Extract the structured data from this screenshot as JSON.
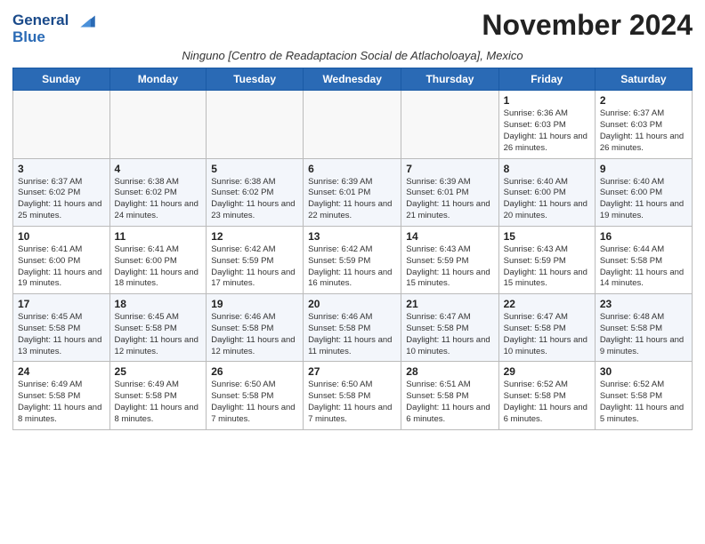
{
  "header": {
    "logo_line1": "General",
    "logo_line2": "Blue",
    "month_title": "November 2024",
    "subtitle": "Ninguno [Centro de Readaptacion Social de Atlacholoaya], Mexico"
  },
  "days_of_week": [
    "Sunday",
    "Monday",
    "Tuesday",
    "Wednesday",
    "Thursday",
    "Friday",
    "Saturday"
  ],
  "weeks": [
    [
      {
        "day": "",
        "info": ""
      },
      {
        "day": "",
        "info": ""
      },
      {
        "day": "",
        "info": ""
      },
      {
        "day": "",
        "info": ""
      },
      {
        "day": "",
        "info": ""
      },
      {
        "day": "1",
        "info": "Sunrise: 6:36 AM\nSunset: 6:03 PM\nDaylight: 11 hours and 26 minutes."
      },
      {
        "day": "2",
        "info": "Sunrise: 6:37 AM\nSunset: 6:03 PM\nDaylight: 11 hours and 26 minutes."
      }
    ],
    [
      {
        "day": "3",
        "info": "Sunrise: 6:37 AM\nSunset: 6:02 PM\nDaylight: 11 hours and 25 minutes."
      },
      {
        "day": "4",
        "info": "Sunrise: 6:38 AM\nSunset: 6:02 PM\nDaylight: 11 hours and 24 minutes."
      },
      {
        "day": "5",
        "info": "Sunrise: 6:38 AM\nSunset: 6:02 PM\nDaylight: 11 hours and 23 minutes."
      },
      {
        "day": "6",
        "info": "Sunrise: 6:39 AM\nSunset: 6:01 PM\nDaylight: 11 hours and 22 minutes."
      },
      {
        "day": "7",
        "info": "Sunrise: 6:39 AM\nSunset: 6:01 PM\nDaylight: 11 hours and 21 minutes."
      },
      {
        "day": "8",
        "info": "Sunrise: 6:40 AM\nSunset: 6:00 PM\nDaylight: 11 hours and 20 minutes."
      },
      {
        "day": "9",
        "info": "Sunrise: 6:40 AM\nSunset: 6:00 PM\nDaylight: 11 hours and 19 minutes."
      }
    ],
    [
      {
        "day": "10",
        "info": "Sunrise: 6:41 AM\nSunset: 6:00 PM\nDaylight: 11 hours and 19 minutes."
      },
      {
        "day": "11",
        "info": "Sunrise: 6:41 AM\nSunset: 6:00 PM\nDaylight: 11 hours and 18 minutes."
      },
      {
        "day": "12",
        "info": "Sunrise: 6:42 AM\nSunset: 5:59 PM\nDaylight: 11 hours and 17 minutes."
      },
      {
        "day": "13",
        "info": "Sunrise: 6:42 AM\nSunset: 5:59 PM\nDaylight: 11 hours and 16 minutes."
      },
      {
        "day": "14",
        "info": "Sunrise: 6:43 AM\nSunset: 5:59 PM\nDaylight: 11 hours and 15 minutes."
      },
      {
        "day": "15",
        "info": "Sunrise: 6:43 AM\nSunset: 5:59 PM\nDaylight: 11 hours and 15 minutes."
      },
      {
        "day": "16",
        "info": "Sunrise: 6:44 AM\nSunset: 5:58 PM\nDaylight: 11 hours and 14 minutes."
      }
    ],
    [
      {
        "day": "17",
        "info": "Sunrise: 6:45 AM\nSunset: 5:58 PM\nDaylight: 11 hours and 13 minutes."
      },
      {
        "day": "18",
        "info": "Sunrise: 6:45 AM\nSunset: 5:58 PM\nDaylight: 11 hours and 12 minutes."
      },
      {
        "day": "19",
        "info": "Sunrise: 6:46 AM\nSunset: 5:58 PM\nDaylight: 11 hours and 12 minutes."
      },
      {
        "day": "20",
        "info": "Sunrise: 6:46 AM\nSunset: 5:58 PM\nDaylight: 11 hours and 11 minutes."
      },
      {
        "day": "21",
        "info": "Sunrise: 6:47 AM\nSunset: 5:58 PM\nDaylight: 11 hours and 10 minutes."
      },
      {
        "day": "22",
        "info": "Sunrise: 6:47 AM\nSunset: 5:58 PM\nDaylight: 11 hours and 10 minutes."
      },
      {
        "day": "23",
        "info": "Sunrise: 6:48 AM\nSunset: 5:58 PM\nDaylight: 11 hours and 9 minutes."
      }
    ],
    [
      {
        "day": "24",
        "info": "Sunrise: 6:49 AM\nSunset: 5:58 PM\nDaylight: 11 hours and 8 minutes."
      },
      {
        "day": "25",
        "info": "Sunrise: 6:49 AM\nSunset: 5:58 PM\nDaylight: 11 hours and 8 minutes."
      },
      {
        "day": "26",
        "info": "Sunrise: 6:50 AM\nSunset: 5:58 PM\nDaylight: 11 hours and 7 minutes."
      },
      {
        "day": "27",
        "info": "Sunrise: 6:50 AM\nSunset: 5:58 PM\nDaylight: 11 hours and 7 minutes."
      },
      {
        "day": "28",
        "info": "Sunrise: 6:51 AM\nSunset: 5:58 PM\nDaylight: 11 hours and 6 minutes."
      },
      {
        "day": "29",
        "info": "Sunrise: 6:52 AM\nSunset: 5:58 PM\nDaylight: 11 hours and 6 minutes."
      },
      {
        "day": "30",
        "info": "Sunrise: 6:52 AM\nSunset: 5:58 PM\nDaylight: 11 hours and 5 minutes."
      }
    ]
  ]
}
